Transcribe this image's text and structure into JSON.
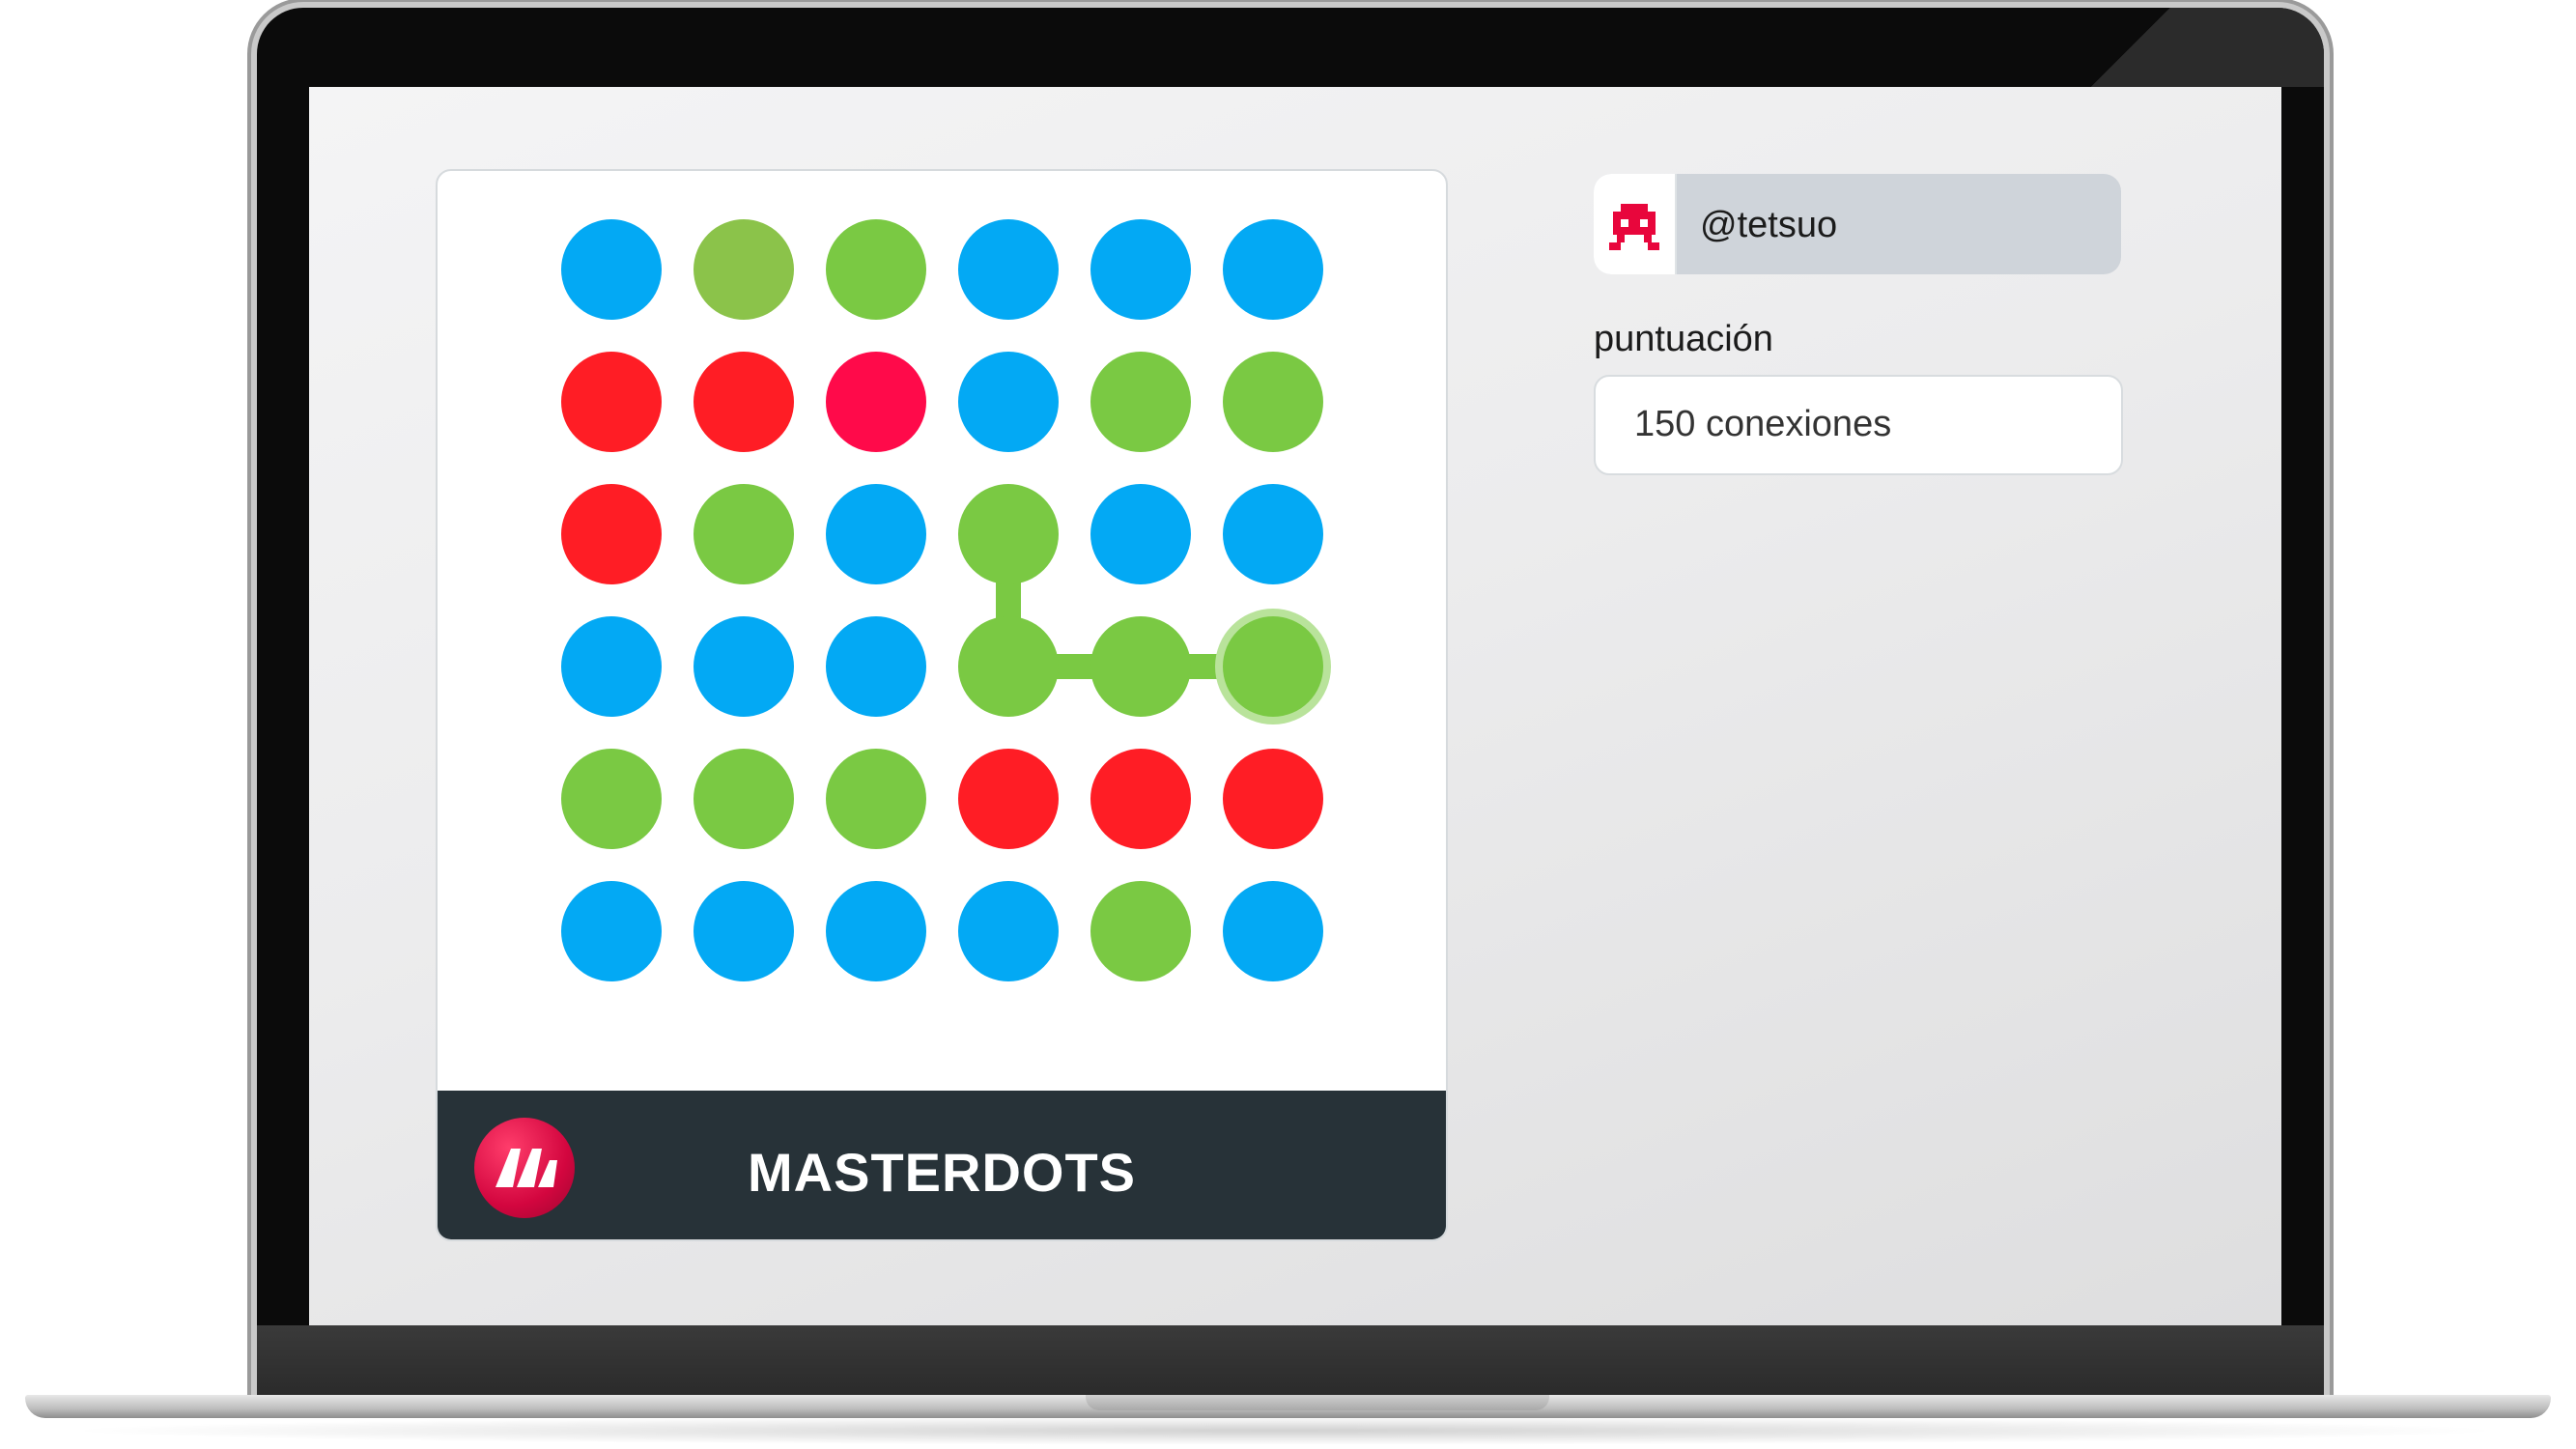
{
  "app": {
    "title": "MASTERDOTS",
    "logo_icon": "masterdots-logo-icon",
    "logo_color": "#e3063f",
    "bar_color": "#273238"
  },
  "player": {
    "username": "@tetsuo",
    "avatar_icon": "space-invader-icon",
    "avatar_color": "#e8063c"
  },
  "score": {
    "label": "puntuación",
    "value": "150 conexiones"
  },
  "colors": {
    "blue": "#03a9f4",
    "green": "#7ac943",
    "olive": "#8bc34a",
    "red": "#ff1d25",
    "crimson": "#ff0a4a"
  },
  "board": {
    "rows": 6,
    "cols": 6,
    "grid": [
      [
        "blue",
        "olive",
        "green",
        "blue",
        "blue",
        "blue"
      ],
      [
        "red",
        "red",
        "crimson",
        "blue",
        "green",
        "green"
      ],
      [
        "red",
        "green",
        "blue",
        "green",
        "blue",
        "blue"
      ],
      [
        "blue",
        "blue",
        "blue",
        "green",
        "green",
        "green"
      ],
      [
        "green",
        "green",
        "green",
        "red",
        "red",
        "red"
      ],
      [
        "blue",
        "blue",
        "blue",
        "blue",
        "green",
        "blue"
      ]
    ],
    "connection": {
      "color": "green",
      "path": [
        [
          2,
          3
        ],
        [
          3,
          3
        ],
        [
          3,
          4
        ],
        [
          3,
          5
        ]
      ],
      "selected_dot": [
        3,
        5
      ]
    }
  }
}
